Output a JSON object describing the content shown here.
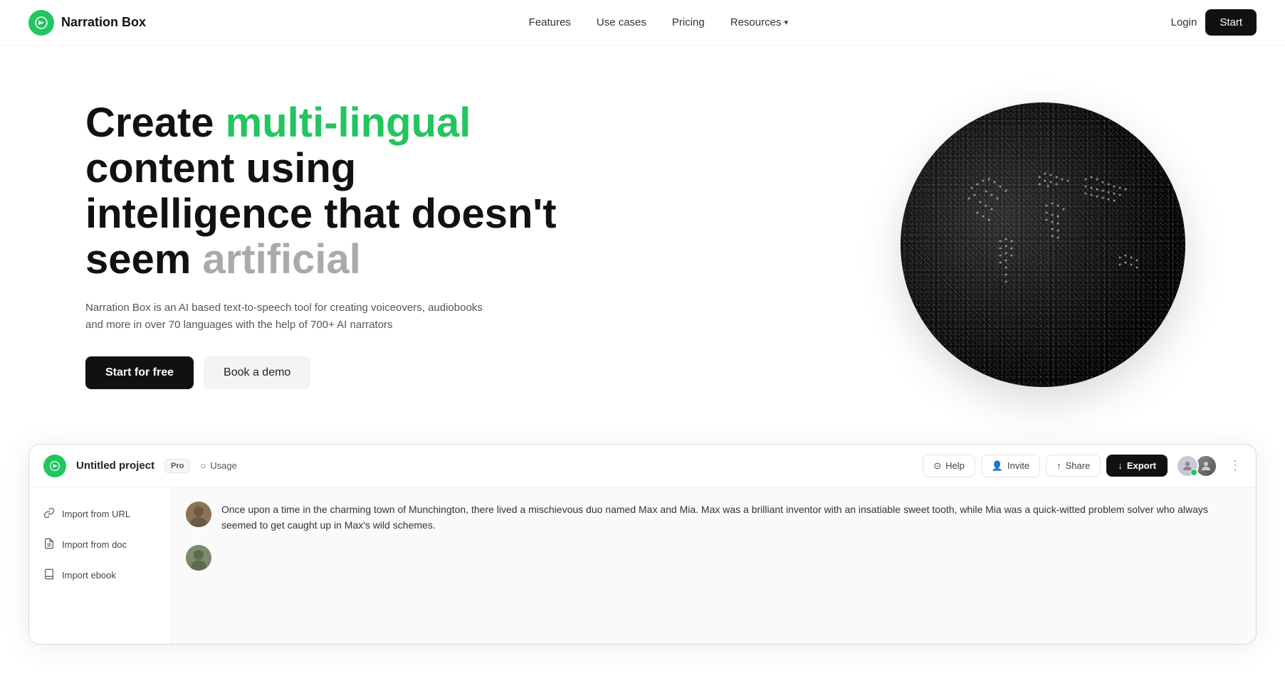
{
  "nav": {
    "logo_text": "Narration Box",
    "logo_icon": "◎",
    "links": [
      {
        "label": "Features",
        "id": "features"
      },
      {
        "label": "Use cases",
        "id": "use-cases"
      },
      {
        "label": "Pricing",
        "id": "pricing"
      },
      {
        "label": "Resources",
        "id": "resources",
        "has_dropdown": true
      }
    ],
    "login_label": "Login",
    "start_label": "Start"
  },
  "hero": {
    "title_part1": "Create ",
    "title_highlight": "multi-lingual",
    "title_part2": " content using intelligence that doesn't seem ",
    "title_muted": "artificial",
    "description": "Narration Box is an AI based text-to-speech tool for creating voiceovers, audiobooks and more in over 70 languages with the help of 700+ AI narrators",
    "cta_primary": "Start for free",
    "cta_secondary": "Book a demo"
  },
  "app": {
    "project_name": "Untitled project",
    "pro_badge": "Pro",
    "usage_label": "Usage",
    "help_label": "Help",
    "invite_label": "Invite",
    "share_label": "Share",
    "export_label": "Export",
    "sidebar_items": [
      {
        "label": "Import from URL",
        "icon": "link"
      },
      {
        "label": "Import from doc",
        "icon": "doc"
      },
      {
        "label": "Import ebook",
        "icon": "book"
      }
    ],
    "content_text": "Once upon a time in the charming town of Munchington, there lived a mischievous duo named Max and Mia. Max was a brilliant inventor with an insatiable sweet tooth, while Mia was a quick-witted problem solver who always seemed to get caught up in Max's wild schemes."
  },
  "colors": {
    "green": "#22c55e",
    "dark": "#111111",
    "border": "#e0d8d0"
  }
}
